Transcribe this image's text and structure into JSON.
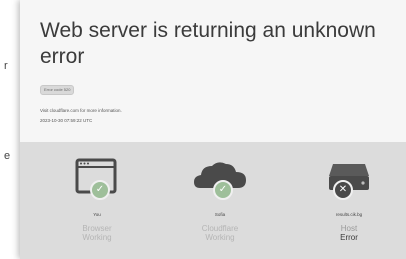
{
  "outer": {
    "left_text_1": "r",
    "left_text_2": "e"
  },
  "error_page": {
    "title": "Web server is returning an unknown error",
    "error_code": "Error code 520",
    "info_line": "Visit cloudflare.com for more information.",
    "timestamp": "2023-10-30 07:59:22 UTC"
  },
  "nodes": [
    {
      "location": "You",
      "label": "Browser",
      "status": "Working",
      "icon": "browser-icon",
      "state": "ok"
    },
    {
      "location": "Sofia",
      "label": "Cloudflare",
      "status": "Working",
      "icon": "cloud-icon",
      "state": "ok"
    },
    {
      "location": "results.cik.bg",
      "label": "Host",
      "status": "Error",
      "icon": "server-icon",
      "state": "error"
    }
  ],
  "colors": {
    "ok": "#9ebf9a",
    "error": "#4a4a4a",
    "band": "#dcdcdc"
  }
}
